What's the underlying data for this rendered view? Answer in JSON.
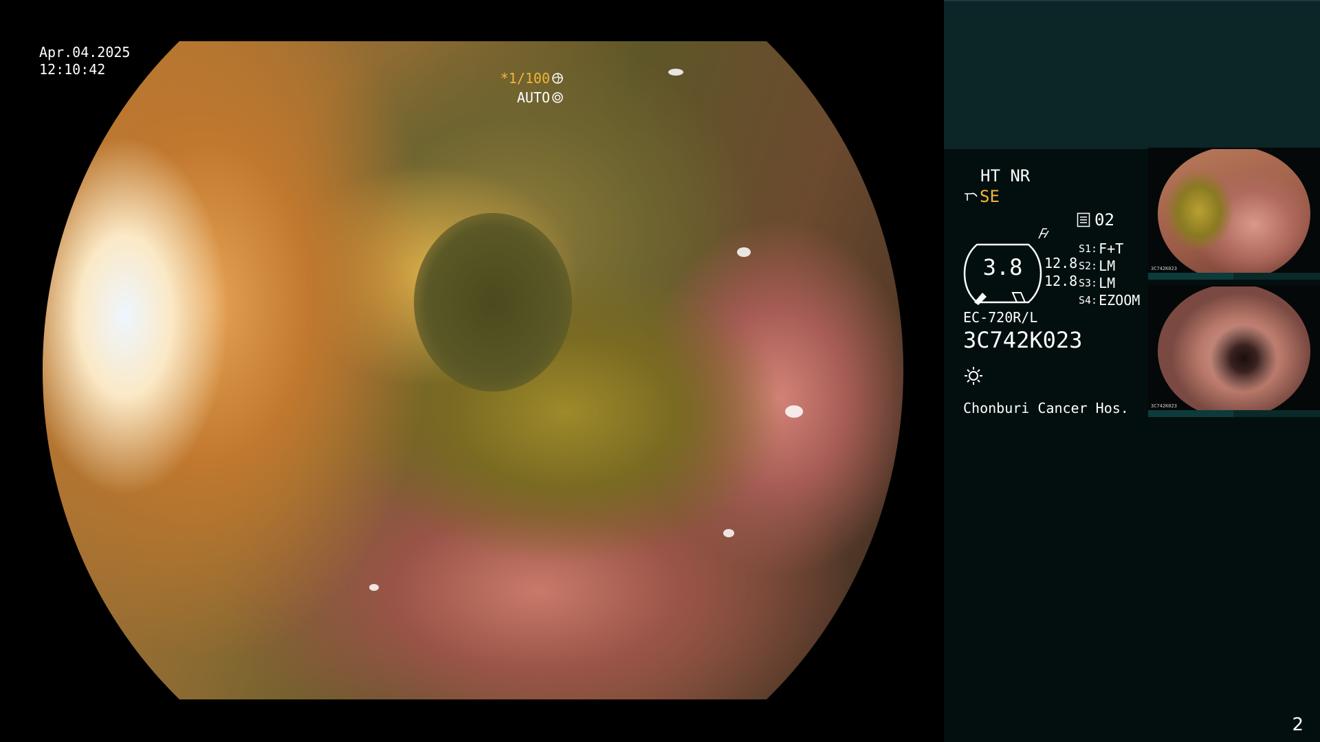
{
  "overlay": {
    "date": "Apr.04.2025",
    "time": "12:10:42",
    "shutter": "*1/100",
    "iris_mode": "AUTO"
  },
  "panel": {
    "ht_nr": "HT NR",
    "enhancement": "SE",
    "mode_number": "02",
    "zoom_value": "3.8",
    "zoom_side_1": "12.8",
    "zoom_side_2": "12.8",
    "switches": [
      {
        "key": "S1:",
        "value": "F+T"
      },
      {
        "key": "S2:",
        "value": "LM"
      },
      {
        "key": "S3:",
        "value": "LM"
      },
      {
        "key": "S4:",
        "value": "EZOOM"
      }
    ],
    "scope_model": "EC-720R/L",
    "scope_serial": "3C742K023",
    "hospital": "Chonburi Cancer Hos."
  },
  "thumbnails": [
    {
      "caption": "3C742K023"
    },
    {
      "caption": "3C742K023"
    }
  ],
  "page": {
    "number": "2"
  },
  "colors": {
    "panel_background": "#030f0f",
    "panel_header_band": "#0c2526",
    "accent_orange": "#f0b63a"
  },
  "icons": {
    "shutter": "aperture-icon",
    "iris": "iris-icon",
    "enhancement": "structure-enhance-icon",
    "color_mode": "color-mode-icon",
    "mode": "mode-list-icon",
    "light": "light-source-icon"
  }
}
